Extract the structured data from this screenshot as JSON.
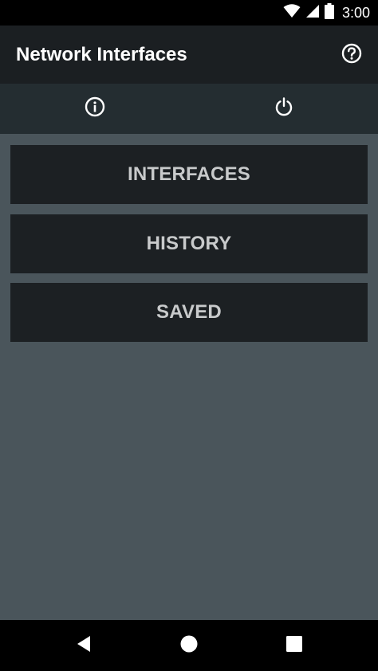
{
  "status_bar": {
    "time": "3:00",
    "icons": [
      "wifi-icon",
      "cellular-signal-icon",
      "battery-icon"
    ]
  },
  "app_bar": {
    "title": "Network Interfaces",
    "help_icon": "help-circle-icon"
  },
  "tabs": [
    {
      "icon": "info-icon"
    },
    {
      "icon": "power-icon"
    }
  ],
  "menu": {
    "interfaces_label": "INTERFACES",
    "history_label": "HISTORY",
    "saved_label": "SAVED"
  },
  "nav_bar": {
    "icons": [
      "back-icon",
      "home-icon",
      "recents-icon"
    ]
  },
  "colors": {
    "background": "#4a555b",
    "app_bar": "#1b1f22",
    "tab_bar": "#242d31",
    "button": "#1c2023",
    "button_text": "#c8cacb"
  }
}
